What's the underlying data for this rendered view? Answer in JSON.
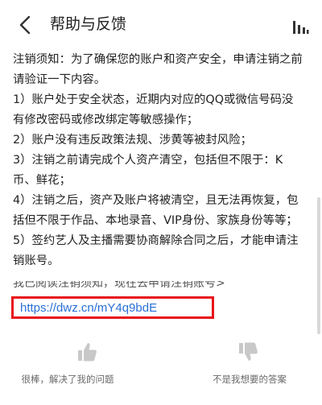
{
  "header": {
    "title": "帮助与反馈",
    "back_icon": "back-arrow-icon",
    "menu_icon": "bars-icon"
  },
  "article": {
    "paragraphs": [
      "注销须知：为了确保您的账户和资产安全，申请注销之前请验证一下内容。",
      "1）账户处于安全状态，近期内对应的QQ或微信号码没有修改密码或修改绑定等敏感操作；",
      "2）账户没有违反政策法规、涉黄等被封风险；",
      "3）注销之前请完成个人资产清空，包括但不限于：K币、鲜花；",
      "4）注销之后，资产及账户将被清空，且无法再恢复，包括但不限于作品、本地录音、VIP身份、家族身份等等；",
      "5）签约艺人及主播需要协商解除合同之后，才能申请注销账号。"
    ],
    "notice_link": "我已阅读注销须知，现在去申请注销账号>",
    "url": "https://dwz.cn/mY4q9bdE"
  },
  "feedback": {
    "helpful_label": "很棒，解决了我的问题",
    "not_helpful_label": "不是我想要的答案"
  },
  "colors": {
    "highlight_border": "#e8141a",
    "link": "#2a6fd6",
    "icon_gray": "#c8c8c8"
  }
}
